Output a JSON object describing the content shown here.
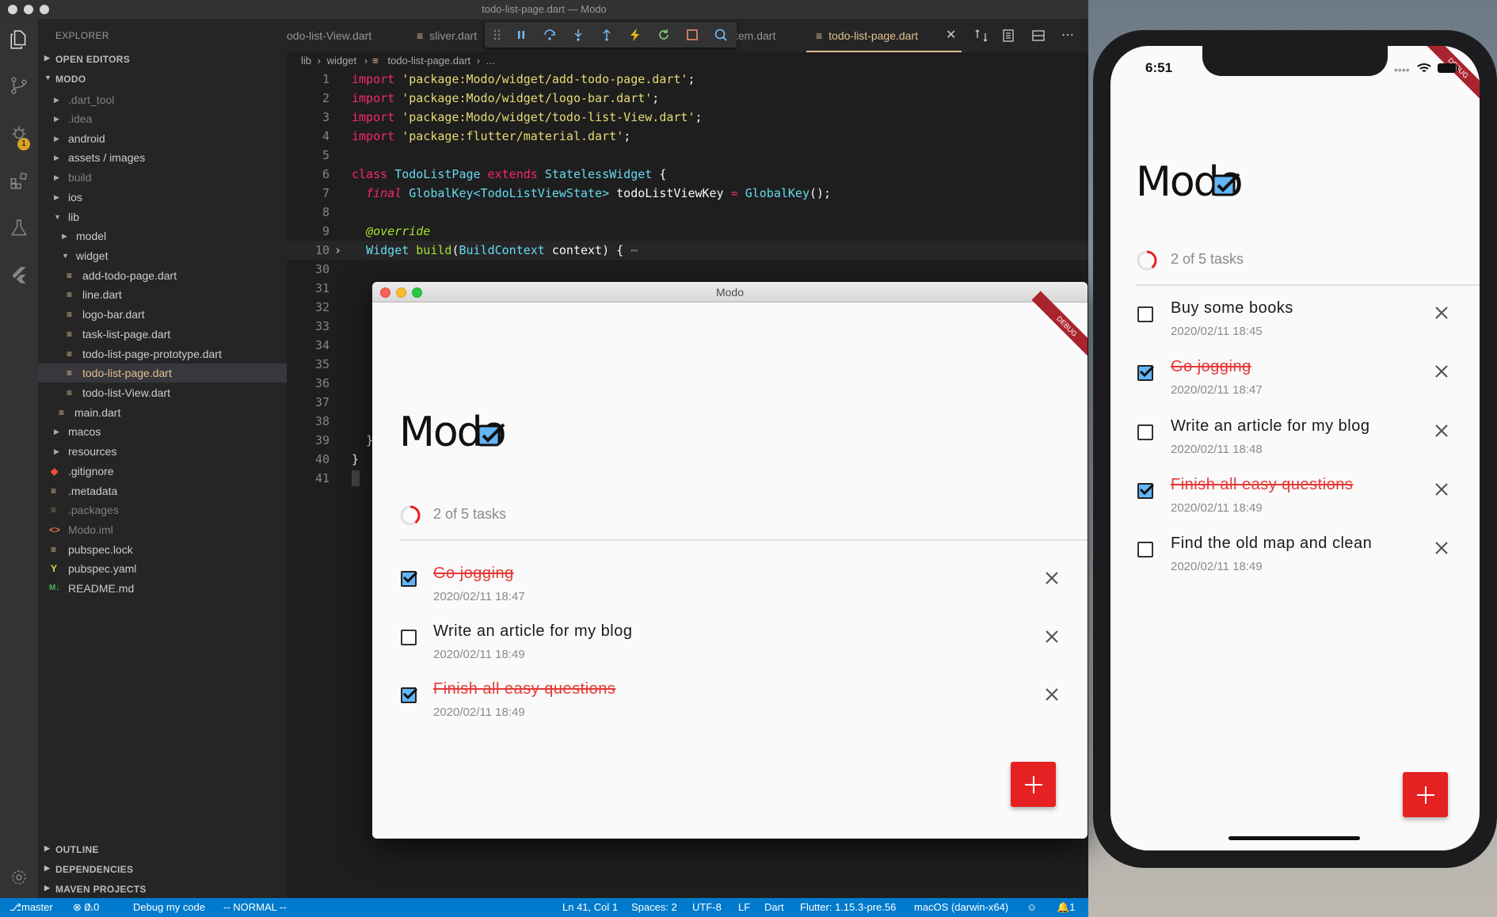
{
  "vscode": {
    "title": "todo-list-page.dart — Modo",
    "explorer": {
      "header": "EXPLORER",
      "open_editors": "OPEN EDITORS",
      "project": "MODO",
      "tree": [
        {
          "label": ".dart_tool",
          "dim": true
        },
        {
          "label": ".idea",
          "dim": true
        },
        {
          "label": "android"
        },
        {
          "label": "assets / images"
        },
        {
          "label": "build",
          "dim": true
        },
        {
          "label": "ios"
        },
        {
          "label": "lib"
        },
        {
          "label": "model"
        },
        {
          "label": "widget"
        },
        {
          "label": "add-todo-page.dart"
        },
        {
          "label": "line.dart"
        },
        {
          "label": "logo-bar.dart"
        },
        {
          "label": "task-list-page.dart"
        },
        {
          "label": "todo-list-page-prototype.dart"
        },
        {
          "label": "todo-list-page.dart",
          "active": true
        },
        {
          "label": "todo-list-View.dart"
        },
        {
          "label": "main.dart"
        },
        {
          "label": "macos"
        },
        {
          "label": "resources"
        },
        {
          "label": ".gitignore"
        },
        {
          "label": ".metadata"
        },
        {
          "label": ".packages",
          "dim": true
        },
        {
          "label": "Modo.iml",
          "dim": true
        },
        {
          "label": "pubspec.lock"
        },
        {
          "label": "pubspec.yaml"
        },
        {
          "label": "README.md"
        }
      ],
      "outline": "OUTLINE",
      "dependencies": "DEPENDENCIES",
      "maven": "MAVEN PROJECTS"
    },
    "tabs": [
      {
        "label": "odo-list-View.dart"
      },
      {
        "label": "sliver.dart"
      },
      {
        "label": "tem.dart"
      },
      {
        "label": "todo-list-page.dart",
        "active": true
      }
    ],
    "breadcrumbs": [
      "lib",
      "widget",
      "todo-list-page.dart",
      "..."
    ],
    "line_numbers": [
      "1",
      "2",
      "3",
      "4",
      "5",
      "6",
      "7",
      "8",
      "9",
      "10",
      "30",
      "31",
      "32",
      "33",
      "34",
      "35",
      "36",
      "37",
      "38",
      "39",
      "40",
      "41"
    ],
    "code": {
      "l1_kw": "import",
      "l1_str": "'package:Modo/widget/add-todo-page.dart'",
      "l2_kw": "import",
      "l2_str": "'package:Modo/widget/logo-bar.dart'",
      "l3_kw": "import",
      "l3_str": "'package:Modo/widget/todo-list-View.dart'",
      "l4_kw": "import",
      "l4_str": "'package:flutter/material.dart'",
      "semi": ";",
      "l6_class": "class",
      "l6_name": "TodoListPage",
      "l6_ext": "extends",
      "l6_base": "StatelessWidget",
      "l6_brace": "{",
      "l7_final": "final",
      "l7_type": "GlobalKey<TodoListViewState>",
      "l7_var": "todoListViewKey",
      "l7_eq": "=",
      "l7_call": "GlobalKey",
      "l7_end": "();",
      "l9_ann": "@override",
      "l10_type": "Widget",
      "l10_fn": "build",
      "l10_p1": "(",
      "l10_ptype": "BuildContext",
      "l10_pname": "context",
      "l10_end": ") {",
      "l39": "}",
      "l40": "}"
    },
    "status": {
      "branch": "master",
      "problems": "0",
      "warnings": "0",
      "debug": "Debug my code",
      "mode": "-- NORMAL --",
      "position": "Ln 41, Col 1",
      "spaces": "Spaces: 2",
      "encoding": "UTF-8",
      "eol": "LF",
      "language": "Dart",
      "flutter": "Flutter: 1.15.3-pre.56",
      "device": "macOS (darwin-x64)",
      "notifications": "1"
    },
    "debug_badge": "1"
  },
  "mac_app": {
    "title": "Modo",
    "debug": "DEBUG",
    "logo": "Modo",
    "progress_text": "2 of 5 tasks",
    "tasks": [
      {
        "title": "Go jogging",
        "date": "2020/02/11 18:47",
        "done": true
      },
      {
        "title": "Write an article for my blog",
        "date": "2020/02/11 18:49",
        "done": false
      },
      {
        "title": "Finish all easy questions",
        "date": "2020/02/11 18:49",
        "done": true
      }
    ]
  },
  "phone_app": {
    "time": "6:51",
    "debug": "DEBUG",
    "logo": "Modo",
    "progress_text": "2 of 5 tasks",
    "tasks": [
      {
        "title": "Buy some books",
        "date": "2020/02/11 18:45",
        "done": false
      },
      {
        "title": "Go jogging",
        "date": "2020/02/11 18:47",
        "done": true
      },
      {
        "title": "Write an article for my blog",
        "date": "2020/02/11 18:48",
        "done": false
      },
      {
        "title": "Finish all easy questions",
        "date": "2020/02/11 18:49",
        "done": true
      },
      {
        "title": "Find the old map and clean",
        "date": "2020/02/11 18:49",
        "done": false
      }
    ]
  },
  "colors": {
    "accent": "#e52121",
    "done_text": "#e53935",
    "checkbox_fill": "#64b5f6",
    "status_bar": "#007acc"
  }
}
